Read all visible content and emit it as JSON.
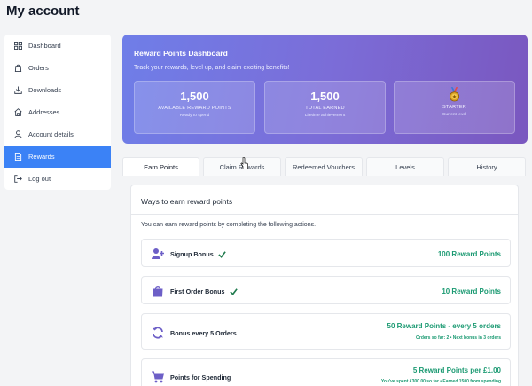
{
  "page": {
    "title": "My account"
  },
  "sidebar": {
    "items": [
      {
        "label": "Dashboard",
        "icon": "dashboard-icon"
      },
      {
        "label": "Orders",
        "icon": "orders-icon"
      },
      {
        "label": "Downloads",
        "icon": "download-icon"
      },
      {
        "label": "Addresses",
        "icon": "home-icon"
      },
      {
        "label": "Account details",
        "icon": "user-icon"
      },
      {
        "label": "Rewards",
        "icon": "document-icon",
        "active": true
      },
      {
        "label": "Log out",
        "icon": "logout-icon"
      }
    ]
  },
  "hero": {
    "title": "Reward Points Dashboard",
    "subtitle": "Track your rewards, level up, and claim exciting benefits!",
    "stats": [
      {
        "value": "1,500",
        "label": "AVAILABLE REWARD POINTS",
        "sub": "Ready to spend"
      },
      {
        "value": "1,500",
        "label": "TOTAL EARNED",
        "sub": "Lifetime achievement"
      },
      {
        "label": "STARTER",
        "sub": "Current level",
        "icon": "medal-icon"
      }
    ]
  },
  "tabs": [
    {
      "label": "Earn Points",
      "active": true
    },
    {
      "label": "Claim Rewards"
    },
    {
      "label": "Redeemed Vouchers"
    },
    {
      "label": "Levels"
    },
    {
      "label": "History"
    }
  ],
  "panel": {
    "title": "Ways to earn reward points",
    "description": "You can earn reward points by completing the following actions.",
    "rows": [
      {
        "name": "Signup Bonus",
        "points": "100 Reward Points",
        "completed": true,
        "icon": "user-plus-icon"
      },
      {
        "name": "First Order Bonus",
        "points": "10 Reward Points",
        "completed": true,
        "icon": "shopping-bag-icon"
      },
      {
        "name": "Bonus every 5 Orders",
        "points": "50 Reward Points - every 5 orders",
        "note": "Orders so far: 2 • Next bonus in 3 orders",
        "icon": "refresh-icon"
      },
      {
        "name": "Points for Spending",
        "points": "5 Reward Points per £1.00",
        "note": "You've spent £300.00 so far • Earned 1500 from spending",
        "icon": "cart-icon"
      }
    ]
  },
  "colors": {
    "accent": "#3b82f6",
    "points_green": "#1b9a72",
    "hero_start": "#6f7ee8",
    "hero_end": "#7a57bf",
    "icon_purple": "#6d5fc7",
    "check_green": "#1f7a4d"
  }
}
